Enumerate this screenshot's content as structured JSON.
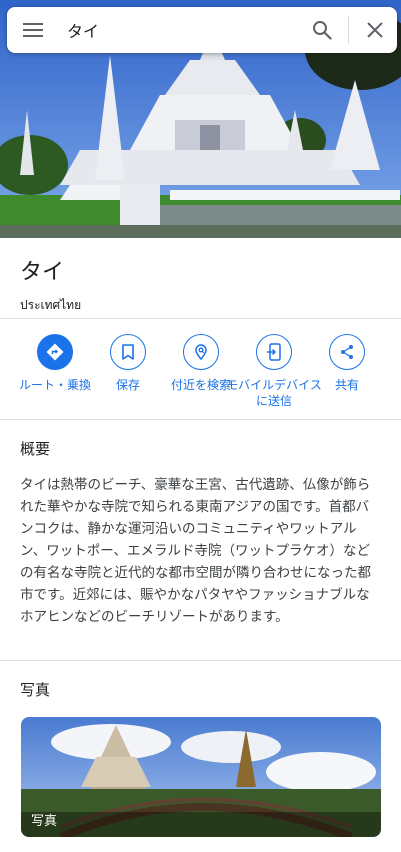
{
  "search": {
    "query": "タイ"
  },
  "place": {
    "name": "タイ",
    "subtitle": "ประเทศไทย"
  },
  "actions": [
    {
      "label": "ルート・乗換",
      "icon": "directions-icon"
    },
    {
      "label": "保存",
      "icon": "bookmark-icon"
    },
    {
      "label": "付近を検索",
      "icon": "nearby-search-icon"
    },
    {
      "label": "モバイルデバイスに送信",
      "icon": "send-to-phone-icon"
    },
    {
      "label": "共有",
      "icon": "share-icon"
    }
  ],
  "overview": {
    "title": "概要",
    "text": "タイは熱帯のビーチ、豪華な王宮、古代遺跡、仏像が飾られた華やかな寺院で知られる東南アジアの国です。首都バンコクは、静かな運河沿いのコミュニティやワットアルン、ワットポー、エメラルド寺院（ワットプラケオ）などの有名な寺院と近代的な都市空間が隣り合わせになった都市です。近郊には、賑やかなパタヤやファッショナブルなホアヒンなどのビーチリゾートがあります。"
  },
  "photos": {
    "title": "写真",
    "card_label": "写真"
  },
  "colors": {
    "accent": "#1a73e8",
    "divider": "#e0e0e0"
  }
}
